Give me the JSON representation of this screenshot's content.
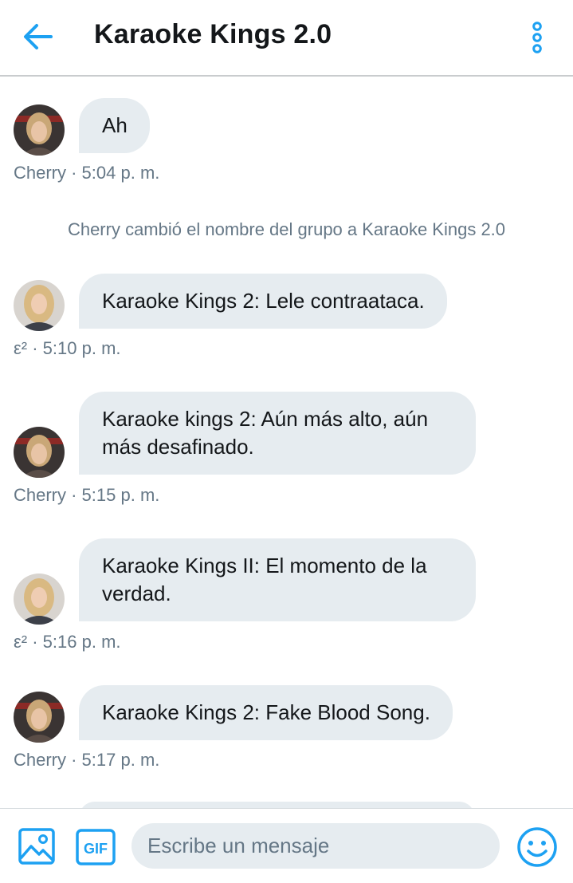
{
  "header": {
    "title": "Karaoke Kings 2.0",
    "back_icon": "arrow-left-icon",
    "more_icon": "more-vertical-icon"
  },
  "colors": {
    "accent": "#1da1f2",
    "bubble": "#e6ecf0",
    "meta_text": "#657786"
  },
  "messages": [
    {
      "text": "Ah",
      "meta": "Cherry · 5:04 p. m.",
      "sender": "Cherry"
    },
    {
      "text": "Karaoke Kings 2: Lele contraataca.",
      "meta": "ε² · 5:10 p. m.",
      "sender": "ε²"
    },
    {
      "text": "Karaoke kings 2: Aún más alto, aún más desafinado.",
      "meta": "Cherry · 5:15 p. m.",
      "sender": "Cherry"
    },
    {
      "text": "Karaoke Kings II: El momento de la verdad.",
      "meta": "ε² · 5:16 p. m.",
      "sender": "ε²"
    },
    {
      "text": "Karaoke Kings 2: Fake Blood Song.",
      "meta": "Cherry · 5:17 p. m.",
      "sender": "Cherry"
    }
  ],
  "system_message": "Cherry cambió el nombre del grupo a Karaoke Kings 2.0",
  "composer": {
    "placeholder": "Escribe un mensaje",
    "image_icon": "image-icon",
    "gif_label": "GIF",
    "emoji_icon": "emoji-icon"
  }
}
